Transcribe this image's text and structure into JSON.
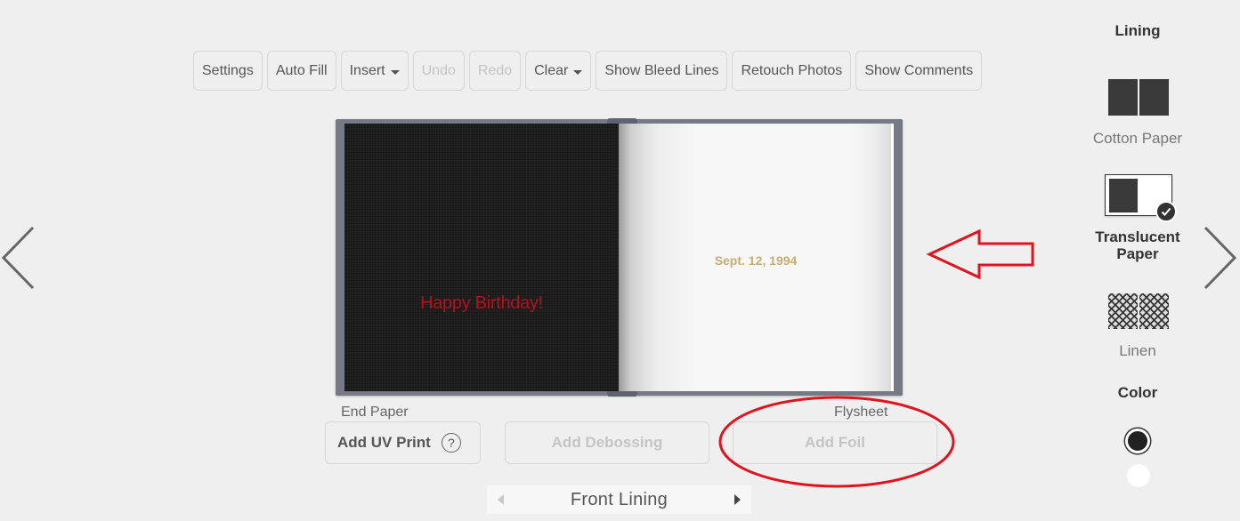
{
  "toolbar": {
    "settings": "Settings",
    "auto_fill": "Auto Fill",
    "insert": "Insert",
    "undo": "Undo",
    "redo": "Redo",
    "clear": "Clear",
    "show_bleed_lines": "Show Bleed Lines",
    "retouch_photos": "Retouch Photos",
    "show_comments": "Show Comments"
  },
  "book": {
    "left_page_text": "Happy Birthday!",
    "right_page_text": "Sept. 12, 1994",
    "left_label": "End Paper",
    "right_label": "Flysheet"
  },
  "actions": {
    "uv_print": "Add UV Print",
    "help_glyph": "?",
    "debossing": "Add Debossing",
    "foil": "Add Foil"
  },
  "pager": {
    "label": "Front Lining"
  },
  "panel": {
    "lining_title": "Lining",
    "options": [
      {
        "label": "Cotton Paper",
        "selected": false
      },
      {
        "label": "Translucent Paper",
        "selected": true
      },
      {
        "label": "Linen",
        "selected": false
      }
    ],
    "color_title": "Color",
    "colors": [
      {
        "name": "black",
        "hex": "#222222",
        "selected": true
      },
      {
        "name": "white",
        "hex": "#ffffff",
        "selected": false
      }
    ]
  },
  "colors": {
    "annotation": "#e0141e",
    "left_page_text": "#b3111d",
    "right_page_text": "#c9ad70"
  },
  "icons": [
    "chevron-left-icon",
    "chevron-right-icon",
    "caret-down-icon",
    "help-icon",
    "checkmark-icon",
    "triangle-left-icon",
    "triangle-right-icon"
  ]
}
